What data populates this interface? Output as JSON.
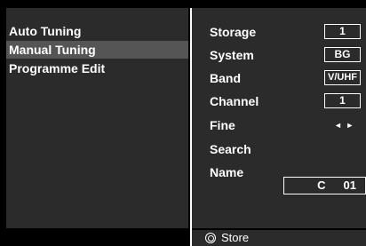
{
  "menu": {
    "items": [
      {
        "label": "Auto Tuning",
        "selected": false
      },
      {
        "label": "Manual Tuning",
        "selected": true
      },
      {
        "label": "Programme Edit",
        "selected": false
      }
    ]
  },
  "settings": {
    "storage": {
      "label": "Storage",
      "value": "1"
    },
    "system": {
      "label": "System",
      "value": "BG"
    },
    "band": {
      "label": "Band",
      "value": "V/UHF"
    },
    "channel": {
      "label": "Channel",
      "value": "1"
    },
    "fine": {
      "label": "Fine",
      "value": "◄ ►"
    },
    "search": {
      "label": "Search"
    },
    "name": {
      "label": "Name",
      "value_prefix": "C",
      "value_number": "01"
    }
  },
  "footer": {
    "store_label": "Store",
    "store_icon": "ok-button-icon"
  }
}
